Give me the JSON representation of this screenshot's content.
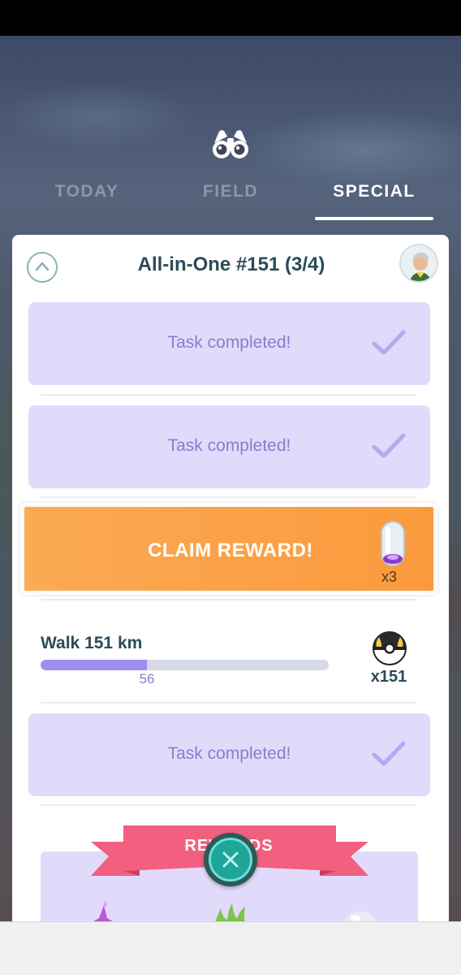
{
  "tabs": [
    {
      "label": "TODAY",
      "active": false
    },
    {
      "label": "FIELD",
      "active": false
    },
    {
      "label": "SPECIAL",
      "active": true
    }
  ],
  "research": {
    "title": "All-in-One #151 (3/4)",
    "tasks": [
      {
        "status": "completed",
        "label": "Task completed!"
      },
      {
        "status": "completed",
        "label": "Task completed!"
      },
      {
        "status": "claim",
        "label": "CLAIM REWARD!",
        "reward_icon": "incubator-icon",
        "reward_qty": "x3"
      },
      {
        "status": "in_progress",
        "label": "Walk 151 km",
        "progress_value": "56",
        "progress_fraction": 0.37,
        "reward_icon": "ultra-ball-icon",
        "reward_qty": "x151"
      },
      {
        "status": "completed",
        "label": "Task completed!"
      }
    ],
    "rewards_label": "REWARDS"
  },
  "icons": {
    "header": "binoculars-icon",
    "collapse": "chevron-up-icon",
    "close": "close-icon",
    "check": "check-icon"
  },
  "colors": {
    "completed_bg": "#e2dafb",
    "claim_orange": "#fb9a3c",
    "progress_fill": "#9f8df0",
    "title_text": "#2b4b57",
    "ribbon": "#f25f7f",
    "close_teal": "#1fa59a"
  }
}
